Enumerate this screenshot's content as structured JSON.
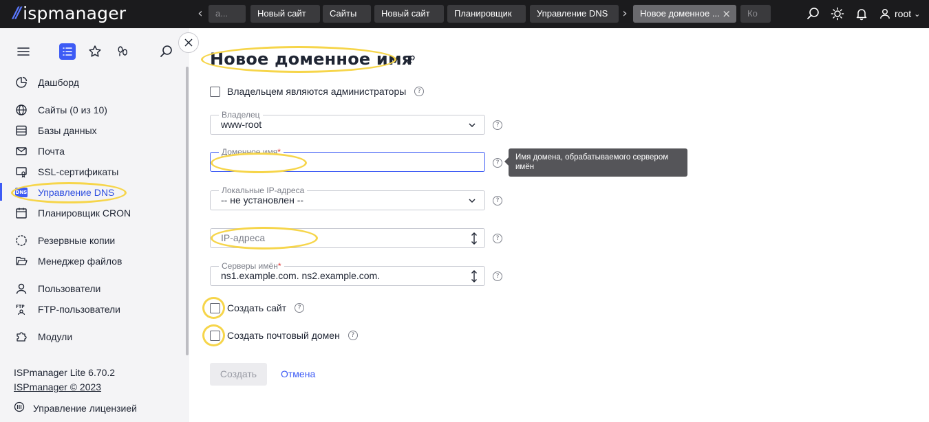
{
  "brand": {
    "name": "ispmanager"
  },
  "tabs": [
    {
      "label": "а..."
    },
    {
      "label": "Новый сайт"
    },
    {
      "label": "Сайты"
    },
    {
      "label": "Новый сайт"
    },
    {
      "label": "Планировщик"
    },
    {
      "label": "Управление DNS"
    },
    {
      "label": "Новое доменное ...",
      "active": true,
      "close": "×"
    },
    {
      "label": "Ко"
    }
  ],
  "topbar": {
    "prev_arrow": "‹",
    "next_arrow": "›",
    "user": "root",
    "user_caret": "⌄"
  },
  "sidebar": {
    "items": [
      {
        "label": "Дашборд",
        "icon": "dashboard-icon"
      },
      {
        "label": "Сайты (0 из 10)",
        "icon": "globe-icon"
      },
      {
        "label": "Базы данных",
        "icon": "database-icon"
      },
      {
        "label": "Почта",
        "icon": "mail-icon"
      },
      {
        "label": "SSL-сертификаты",
        "icon": "certificate-icon"
      },
      {
        "label": "Управление DNS",
        "icon": "dns-icon",
        "active": true
      },
      {
        "label": "Планировщик CRON",
        "icon": "calendar-icon"
      },
      {
        "label": "Резервные копии",
        "icon": "backup-icon"
      },
      {
        "label": "Менеджер файлов",
        "icon": "folder-icon"
      },
      {
        "label": "Пользователи",
        "icon": "user-icon"
      },
      {
        "label": "FTP-пользователи",
        "icon": "ftp-icon"
      },
      {
        "label": "Модули",
        "icon": "puzzle-icon"
      }
    ],
    "dns_badge": "DNS",
    "version": "ISPmanager Lite 6.70.2",
    "copyright": "ISPmanager © 2023",
    "license": "Управление лицензией"
  },
  "form": {
    "title": "Новое доменное имя",
    "admin_owner_label": "Владельцем являются администраторы",
    "owner": {
      "legend": "Владелец",
      "value": "www-root"
    },
    "domain": {
      "legend": "Доменное имя",
      "required": "*",
      "value": ""
    },
    "local_ip": {
      "legend": "Локальные IP-адреса",
      "value": "-- не установлен --"
    },
    "ip": {
      "placeholder": "IP-адреса"
    },
    "nameservers": {
      "legend": "Серверы имён",
      "required": "*",
      "value": "ns1.example.com. ns2.example.com."
    },
    "create_site_label": "Создать сайт",
    "create_mail_label": "Создать почтовый домен",
    "help_glyph": "?",
    "tooltip": "Имя домена, обрабатываемого сервером имён",
    "submit_label": "Создать",
    "cancel_label": "Отмена"
  },
  "colors": {
    "accent": "#3d5bf5",
    "highlight": "#f6d54a",
    "topbar": "#1b1b1d",
    "sidebar": "#f4f4f6"
  }
}
